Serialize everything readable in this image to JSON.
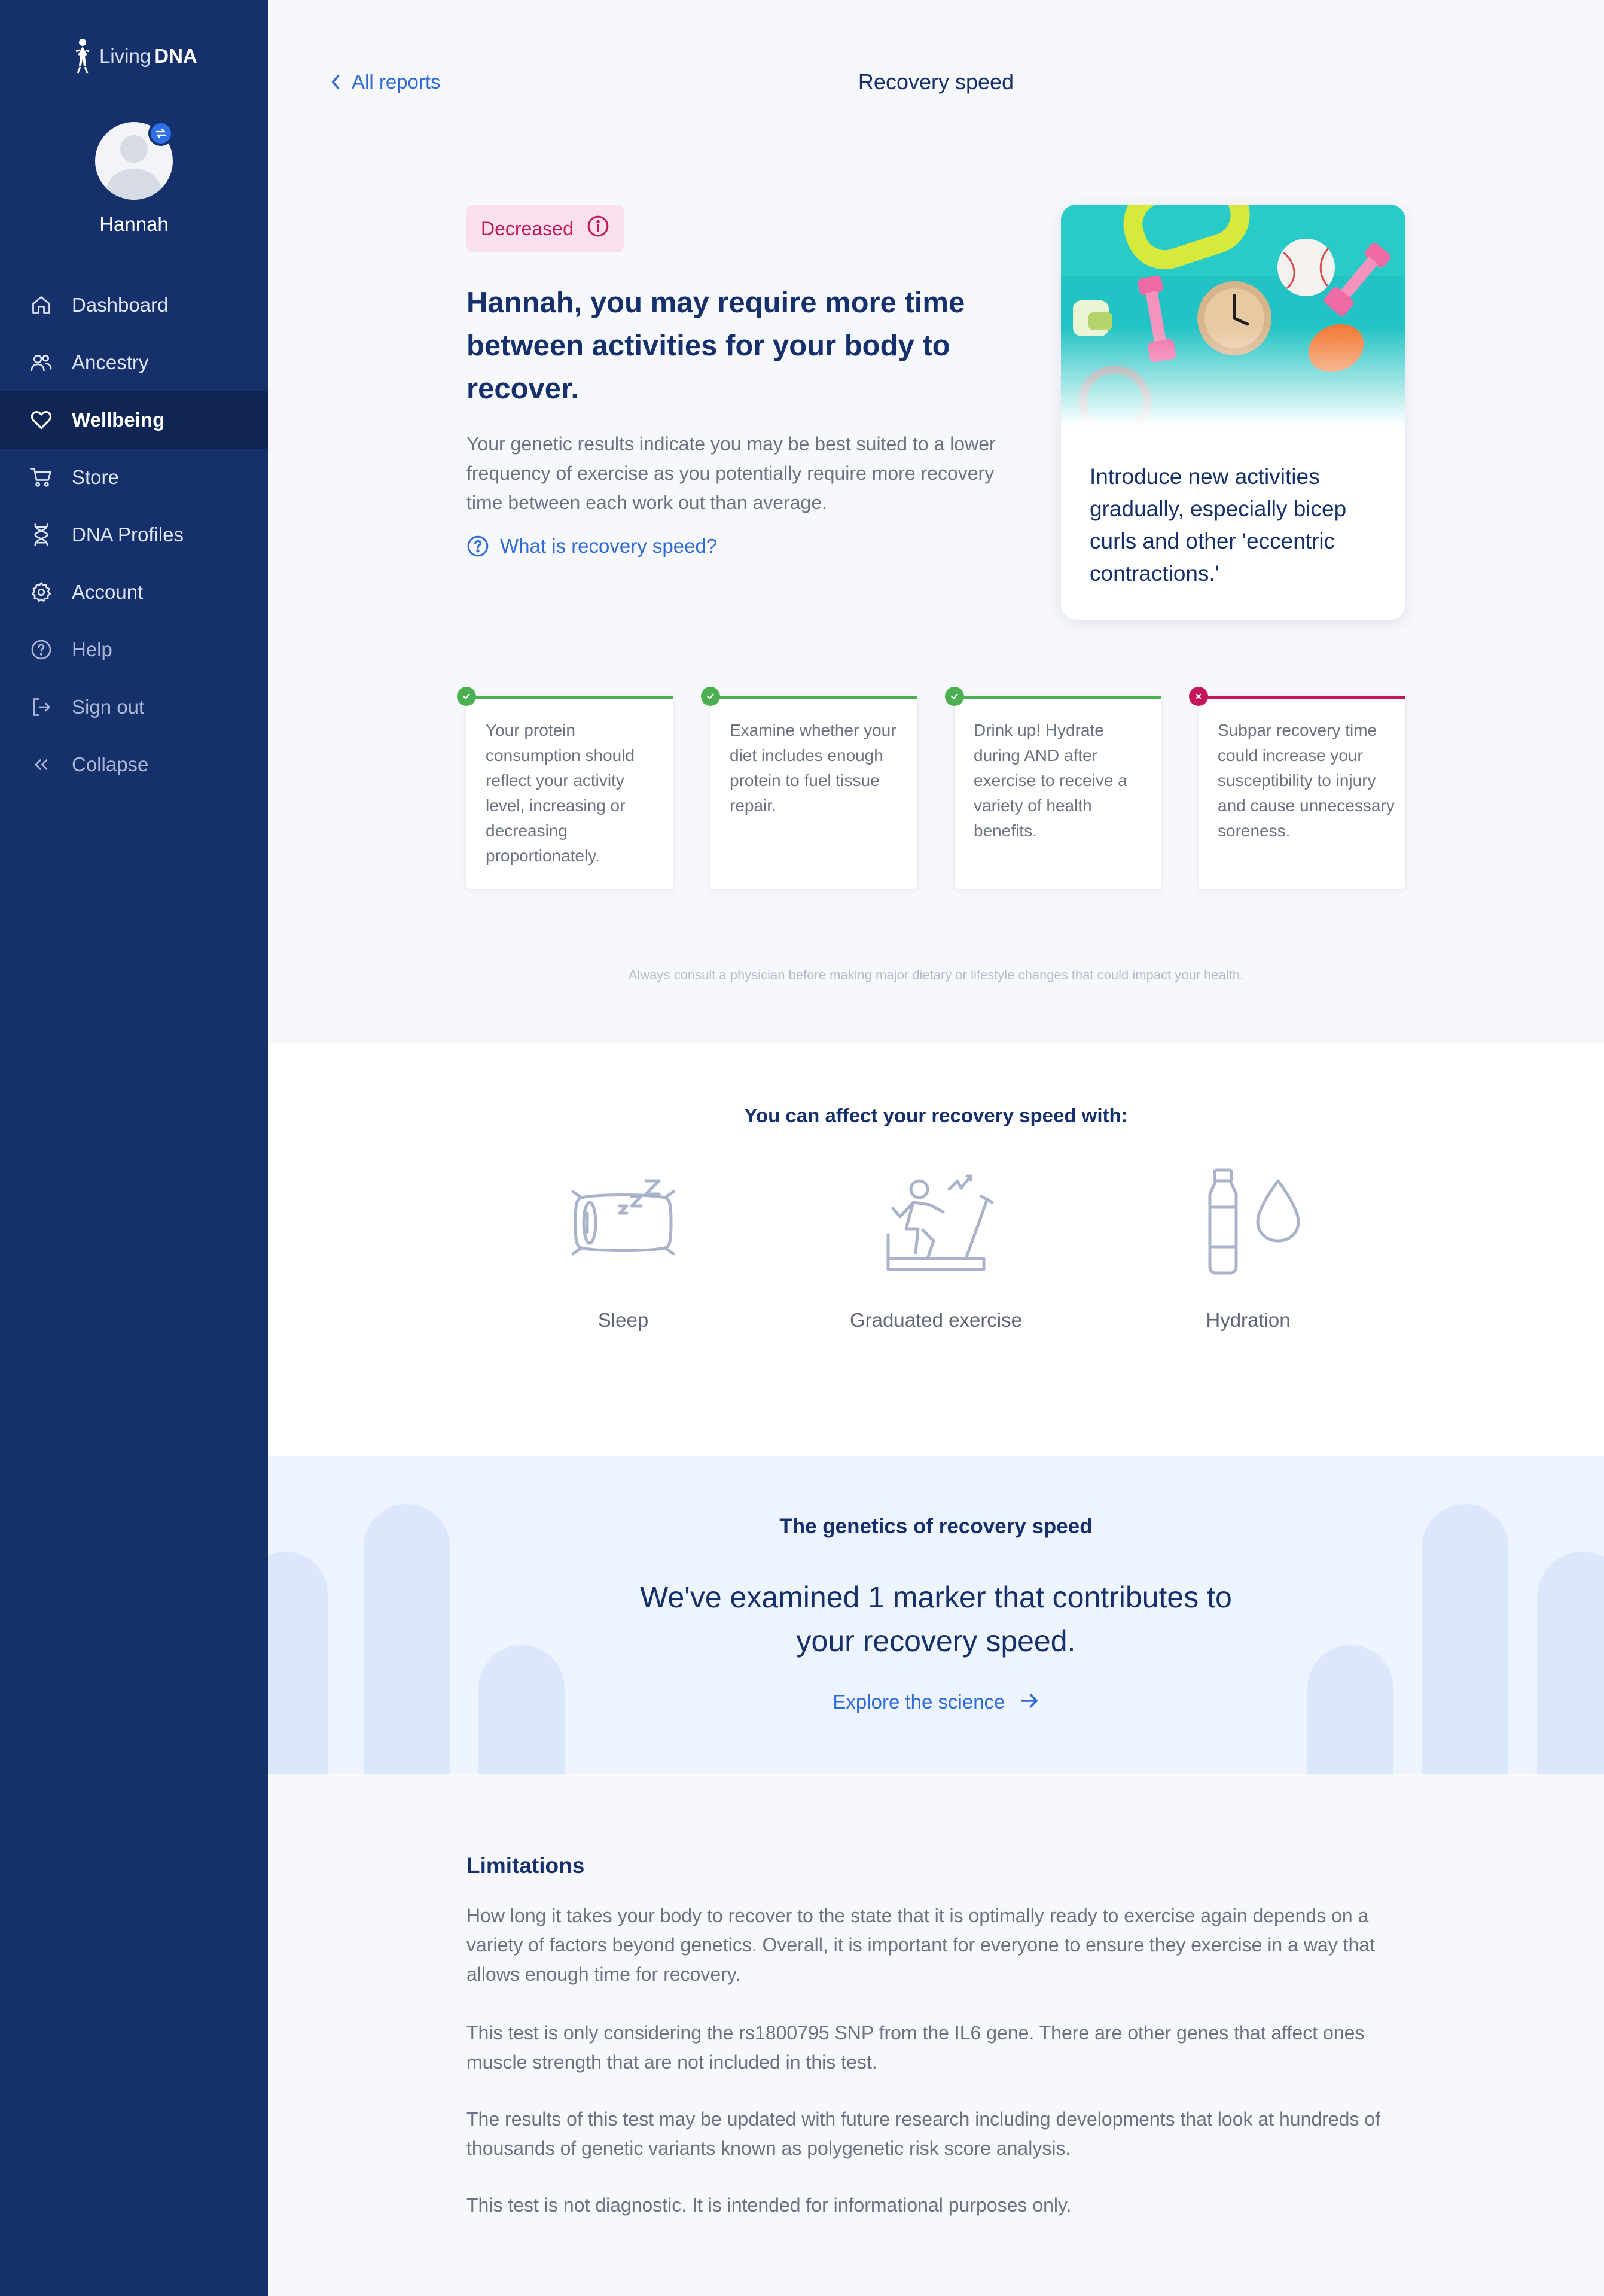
{
  "app": {
    "logo_word1": "Living",
    "logo_word2": "DNA"
  },
  "user": {
    "name": "Hannah"
  },
  "nav": [
    {
      "label": "Dashboard",
      "icon": "home-icon"
    },
    {
      "label": "Ancestry",
      "icon": "people-icon"
    },
    {
      "label": "Wellbeing",
      "icon": "heart-icon",
      "active": true
    },
    {
      "label": "Store",
      "icon": "cart-icon"
    },
    {
      "label": "DNA Profiles",
      "icon": "dna-icon"
    },
    {
      "label": "Account",
      "icon": "gear-icon"
    },
    {
      "label": "Help",
      "icon": "help-icon"
    },
    {
      "label": "Sign out",
      "icon": "sign-out-icon"
    },
    {
      "label": "Collapse",
      "icon": "collapse-icon"
    }
  ],
  "header": {
    "back_label": "All reports",
    "title": "Recovery speed"
  },
  "hero": {
    "badge": "Decreased",
    "title": "Hannah, you may require more time between activities for your body to recover.",
    "text": "Your genetic results indicate you may be best suited to a lower frequency of exercise as you potentially require more recovery time between each work out than average.",
    "link": "What is recovery speed?"
  },
  "tip": {
    "text": "Introduce new activities gradually, especially bicep curls and other 'eccentric contractions.'"
  },
  "facts": [
    {
      "status": "good",
      "text": "Your protein consumption should reflect your activity level, increasing or decreasing proportionately."
    },
    {
      "status": "good",
      "text": "Examine whether your diet includes enough protein to fuel tissue repair."
    },
    {
      "status": "good",
      "text": "Drink up! Hydrate during AND after exercise to receive a variety of health benefits."
    },
    {
      "status": "bad",
      "text": "Subpar recovery time could increase your susceptibility to injury and cause unnecessary soreness."
    }
  ],
  "disclaimer": "Always consult a physician before making major dietary or lifestyle changes that could impact your health.",
  "affect": {
    "title": "You can affect your recovery speed with:",
    "factors": [
      {
        "label": "Sleep",
        "icon": "sleep-icon"
      },
      {
        "label": "Graduated exercise",
        "icon": "exercise-icon"
      },
      {
        "label": "Hydration",
        "icon": "hydration-icon"
      }
    ]
  },
  "genetics": {
    "kicker": "The genetics of recovery speed",
    "title": "We've examined 1 marker that contributes to your recovery speed.",
    "link": "Explore the science"
  },
  "limitations": {
    "title": "Limitations",
    "paragraphs": [
      "How long it takes your body to recover to the state that it is optimally ready to exercise again depends on a variety of factors beyond genetics. Overall, it is important for everyone to ensure they exercise in a way that allows enough time for recovery.",
      "This test is only considering the rs1800795 SNP from the IL6 gene. There are other genes that affect ones muscle strength that are not included in this test.",
      "The results of this test may be updated with future research including developments that look at hundreds of thousands of genetic variants known as polygenetic risk score analysis.",
      "This test is not diagnostic. It is intended for informational purposes only."
    ]
  },
  "colors": {
    "sidebar": "#15306b",
    "accent": "#2e6bd6",
    "good": "#4caf50",
    "bad": "#c2185b"
  }
}
